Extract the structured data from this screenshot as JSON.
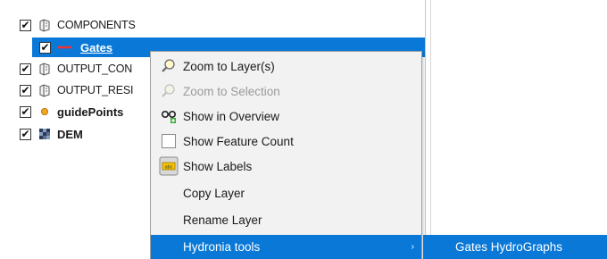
{
  "layers_tree": {
    "items": [
      {
        "label": "COMPONENTS",
        "checked": "✔",
        "icon": "layer-group-icon"
      },
      {
        "label": "Gates",
        "checked": "✔",
        "icon": "line-symbol-icon"
      },
      {
        "label": "OUTPUT_CON",
        "checked": "✔",
        "icon": "layer-group-icon"
      },
      {
        "label": "OUTPUT_RESI",
        "checked": "✔",
        "icon": "layer-group-icon"
      },
      {
        "label": "guidePoints",
        "checked": "✔",
        "icon": "point-symbol-icon"
      },
      {
        "label": "DEM",
        "checked": "✔",
        "icon": "raster-icon"
      }
    ]
  },
  "context_menu": {
    "items": [
      {
        "label": "Zoom to Layer(s)",
        "icon": "zoom-icon",
        "enabled": true
      },
      {
        "label": "Zoom to Selection",
        "icon": "zoom-icon",
        "enabled": false
      },
      {
        "label": "Show in Overview",
        "icon": "overview-icon",
        "enabled": true
      },
      {
        "label": "Show Feature Count",
        "icon": "checkbox-icon",
        "enabled": true
      },
      {
        "label": "Show Labels",
        "icon": "labels-icon",
        "enabled": true
      },
      {
        "label": "Copy Layer",
        "icon": "",
        "enabled": true
      },
      {
        "label": "Rename Layer",
        "icon": "",
        "enabled": true
      },
      {
        "label": "Hydronia tools",
        "icon": "",
        "enabled": true,
        "has_submenu": true
      }
    ],
    "submenu_arrow": "›"
  },
  "submenu": {
    "items": [
      {
        "label": "Gates HydroGraphs"
      }
    ]
  },
  "colors": {
    "selection": "#0a78d7",
    "menu_bg": "#f2f2f2",
    "disabled_text": "#9a9a9a"
  }
}
